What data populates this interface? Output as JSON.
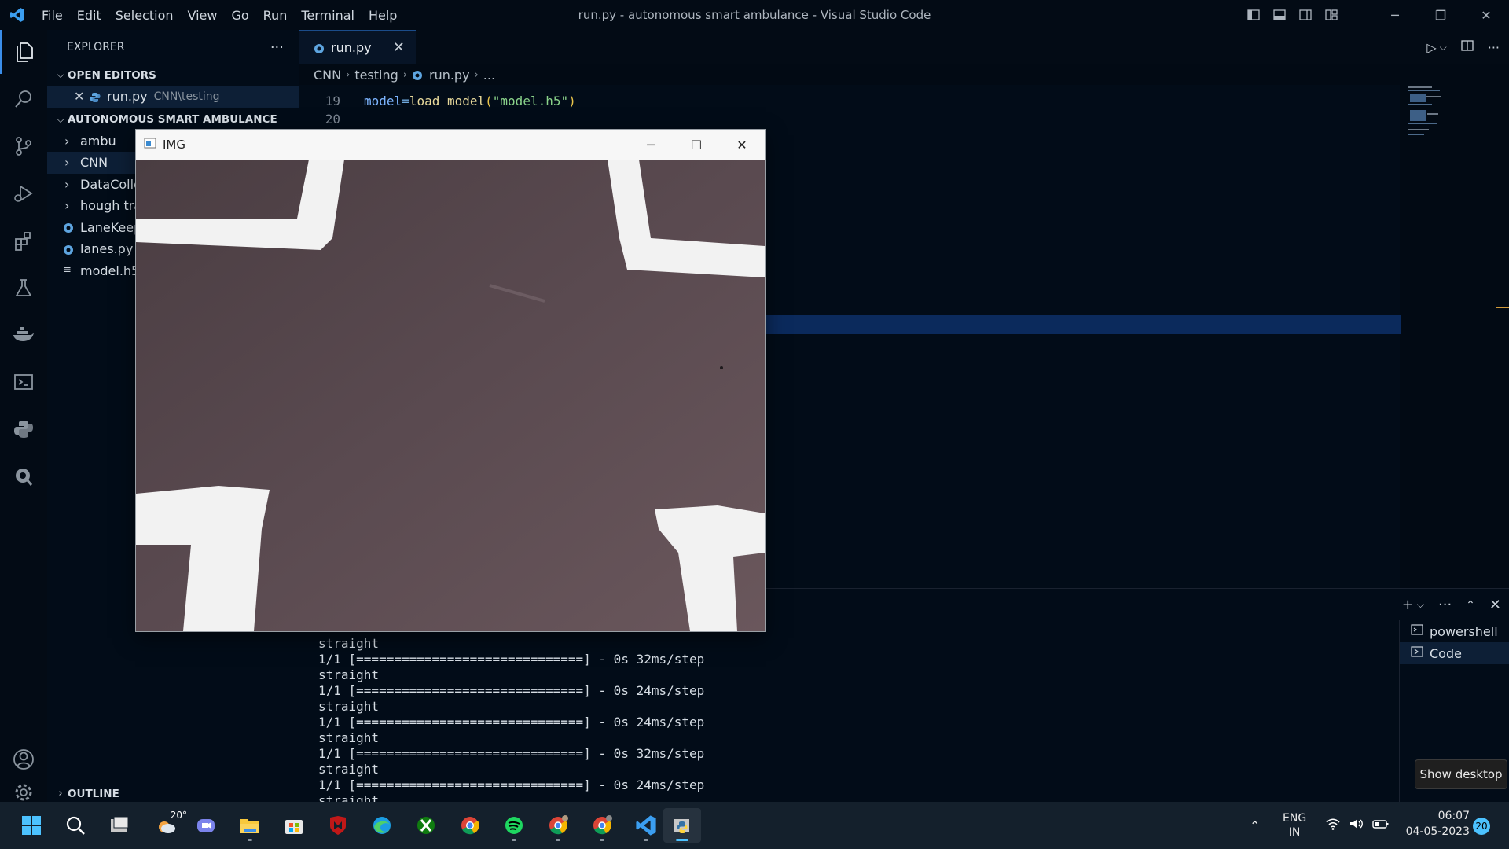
{
  "window": {
    "title": "run.py - autonomous smart ambulance - Visual Studio Code",
    "menu": [
      "File",
      "Edit",
      "Selection",
      "View",
      "Go",
      "Run",
      "Terminal",
      "Help"
    ]
  },
  "sidebar": {
    "header": "EXPLORER",
    "more": "···",
    "open_editors_title": "OPEN EDITORS",
    "open_editor": {
      "name": "run.py",
      "path": "CNN\\testing"
    },
    "project_title": "AUTONOMOUS SMART AMBULANCE",
    "items": [
      {
        "label": "ambu",
        "type": "folder"
      },
      {
        "label": "CNN",
        "type": "folder"
      },
      {
        "label": "DataColle",
        "type": "folder"
      },
      {
        "label": "hough tra",
        "type": "folder"
      },
      {
        "label": "LaneKeep",
        "type": "python"
      },
      {
        "label": "lanes.py",
        "type": "python"
      },
      {
        "label": "model.h5",
        "type": "file"
      }
    ],
    "outline_title": "OUTLINE"
  },
  "tabs": [
    {
      "label": "run.py",
      "active": true
    }
  ],
  "breadcrumb": [
    "CNN",
    "testing",
    "run.py",
    "..."
  ],
  "editor": {
    "lines": [
      {
        "number": "19",
        "var": "model",
        "op": "=",
        "fn": "load_model",
        "open": "(",
        "str": "\"model.h5\"",
        "close": ")"
      },
      {
        "number": "20"
      }
    ]
  },
  "image_window": {
    "title": "IMG",
    "minimize": "─",
    "maximize": "☐",
    "close": "✕"
  },
  "terminal": {
    "output": "straight\n1/1 [==============================] - 0s 32ms/step\nstraight\n1/1 [==============================] - 0s 24ms/step\nstraight\n1/1 [==============================] - 0s 24ms/step\nstraight\n1/1 [==============================] - 0s 32ms/step\nstraight\n1/1 [==============================] - 0s 24ms/step\nstraight",
    "sessions": [
      {
        "label": "powershell",
        "selected": false
      },
      {
        "label": "Code",
        "selected": true
      }
    ]
  },
  "tooltip": "Show desktop",
  "taskbar": {
    "weather": "20°",
    "language": {
      "line1": "ENG",
      "line2": "IN"
    },
    "time": "06:07",
    "date": "04-05-2023",
    "notifications": "20"
  },
  "colors": {
    "accent": "#3b8eea",
    "editor_bg": "#020c18",
    "selection": "#0b2a5c"
  }
}
